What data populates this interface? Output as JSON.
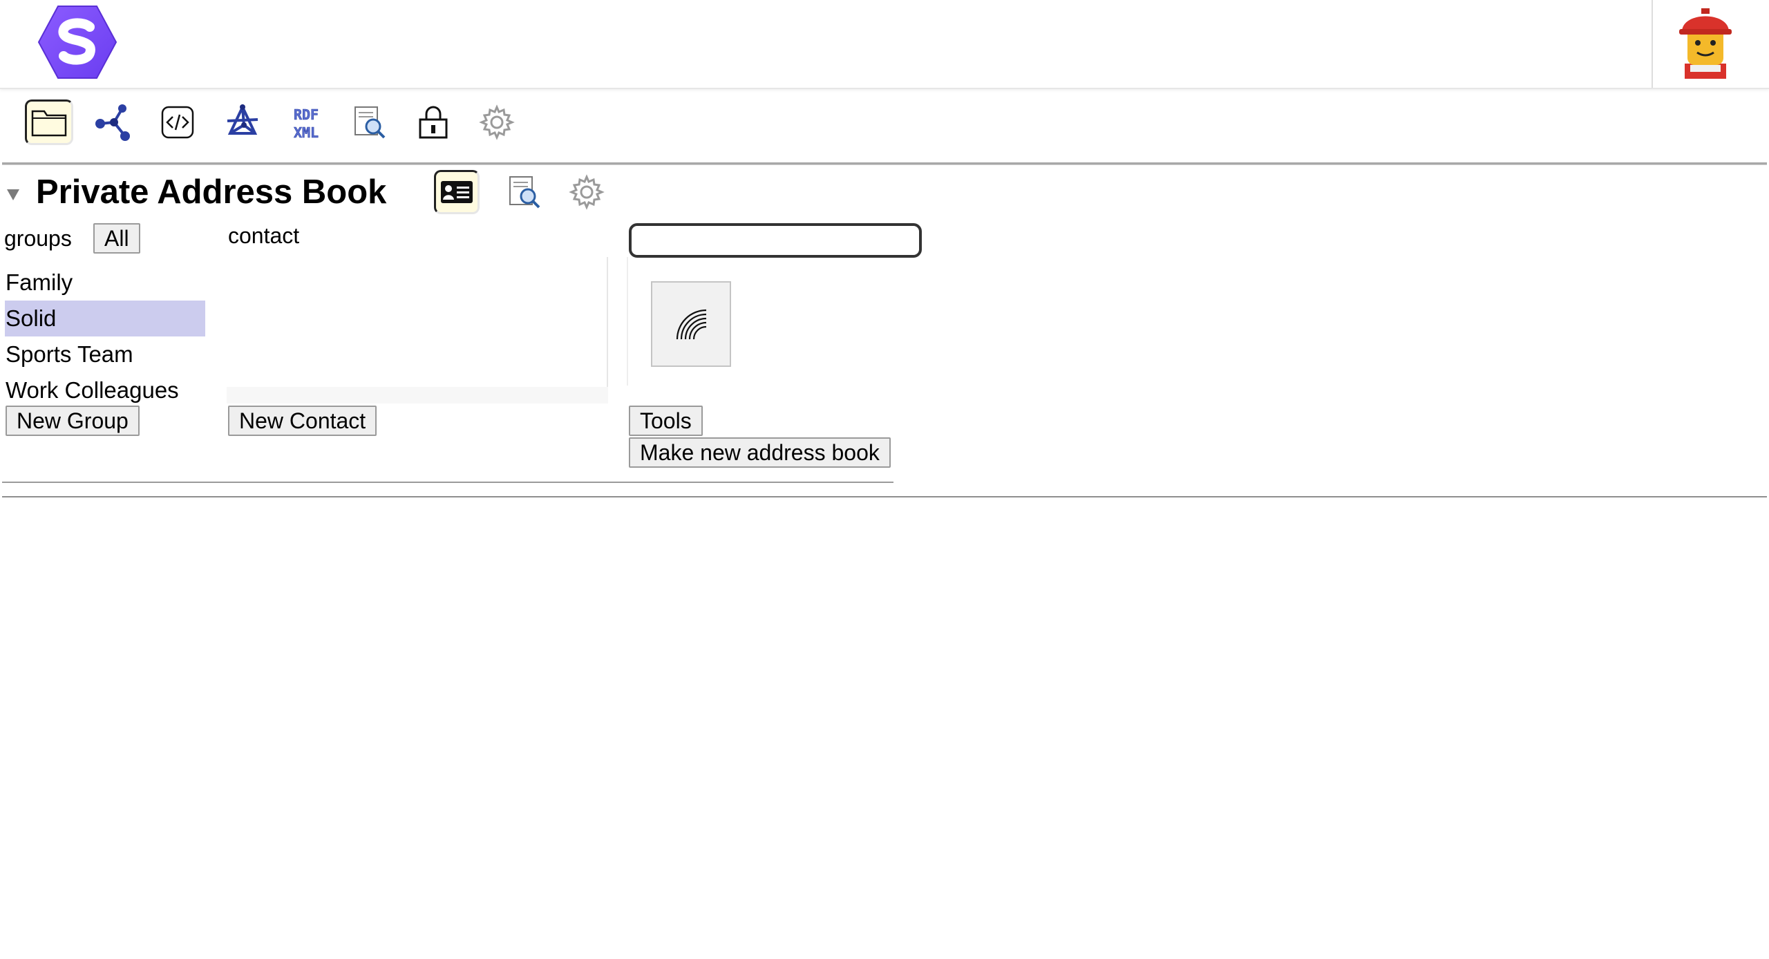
{
  "header": {
    "logo_icon": "solid-logo-icon",
    "avatar_icon": "user-avatar-icon"
  },
  "toolbar": {
    "icons": [
      "folder-icon",
      "network-icon",
      "code-icon",
      "graph-icon",
      "rdf-xml-icon",
      "document-search-icon",
      "lock-icon",
      "gear-icon"
    ],
    "rdf_label_top": "RDF",
    "rdf_label_bottom": "XML"
  },
  "addressbook": {
    "title": "Private Address Book",
    "header_icons": [
      "contact-card-icon",
      "document-search-icon",
      "gear-icon"
    ],
    "groups_label": "groups",
    "all_button": "All",
    "groups": [
      {
        "label": "Family",
        "selected": false
      },
      {
        "label": "Solid",
        "selected": true
      },
      {
        "label": "Sports Team",
        "selected": false
      },
      {
        "label": "Work Colleagues",
        "selected": false
      }
    ],
    "new_group_button": "New Group",
    "contact_label": "contact",
    "new_contact_button": "New Contact",
    "search_value": "",
    "tools_button": "Tools",
    "make_new_button": "Make new address book"
  },
  "colors": {
    "selected_group_bg": "#ccccee",
    "active_icon_bg": "#fffbe0",
    "logo_purple": "#7c4dff"
  }
}
